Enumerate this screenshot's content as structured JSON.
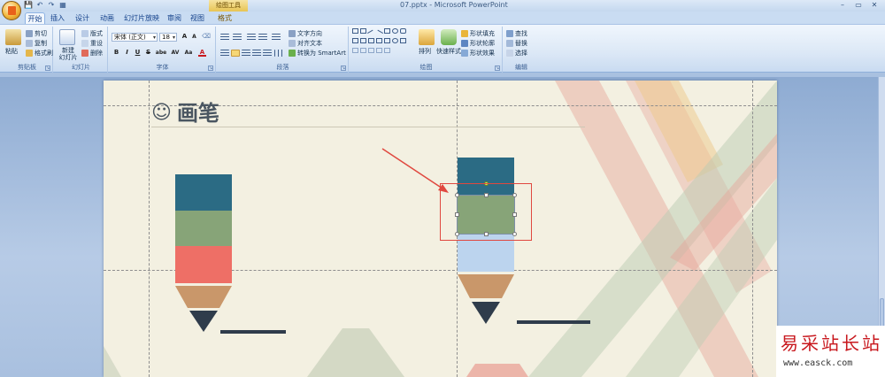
{
  "window": {
    "title": "07.pptx - Microsoft PowerPoint",
    "contextual_tools": "绘图工具",
    "controls": [
      "–",
      "▭",
      "✕"
    ]
  },
  "quick_access": [
    "💾",
    "↶",
    "↷",
    "▦"
  ],
  "tabs": [
    {
      "label": "开始",
      "active": true
    },
    {
      "label": "插入"
    },
    {
      "label": "设计"
    },
    {
      "label": "动画"
    },
    {
      "label": "幻灯片放映"
    },
    {
      "label": "审阅"
    },
    {
      "label": "视图"
    },
    {
      "label": "格式",
      "contextual": true
    }
  ],
  "ribbon": {
    "clipboard": {
      "label": "剪贴板",
      "paste": "粘贴",
      "cut": "剪切",
      "copy": "复制",
      "format_painter": "格式刷"
    },
    "slides": {
      "label": "幻灯片",
      "new_slide": "新建\n幻灯片",
      "layout": "版式",
      "reset": "重设",
      "delete": "删除"
    },
    "font": {
      "label": "字体",
      "font_name": "宋体 (正文)",
      "font_size": "18",
      "bold": "B",
      "italic": "I",
      "underline": "U",
      "strike": "S",
      "shadow": "abe",
      "spacing": "AV",
      "case": "Aa",
      "color": "A"
    },
    "paragraph": {
      "label": "段落",
      "text_direction": "文字方向",
      "align_text": "对齐文本",
      "smartart": "转换为 SmartArt"
    },
    "drawing": {
      "label": "绘图",
      "arrange": "排列",
      "quick_styles": "快速样式",
      "shape_fill": "形状填充",
      "shape_outline": "形状轮廓",
      "shape_effects": "形状效果"
    },
    "editing": {
      "label": "编辑",
      "find": "查找",
      "replace": "替换",
      "select": "选择"
    }
  },
  "slide": {
    "title_icon": "☺",
    "title": "画笔"
  },
  "watermark": {
    "text": "易采站长站",
    "url": "www.easck.com"
  },
  "colors": {
    "teal": "#2b6b84",
    "sage": "#87a478",
    "coral": "#ee6f66",
    "tan": "#c9976a",
    "navy": "#2f3c4b",
    "light_blue": "#c3d7ee",
    "pale_blue": "#bcd4ee",
    "annotation_red": "#e0483f",
    "slide_bg": "#f3f0e1"
  }
}
